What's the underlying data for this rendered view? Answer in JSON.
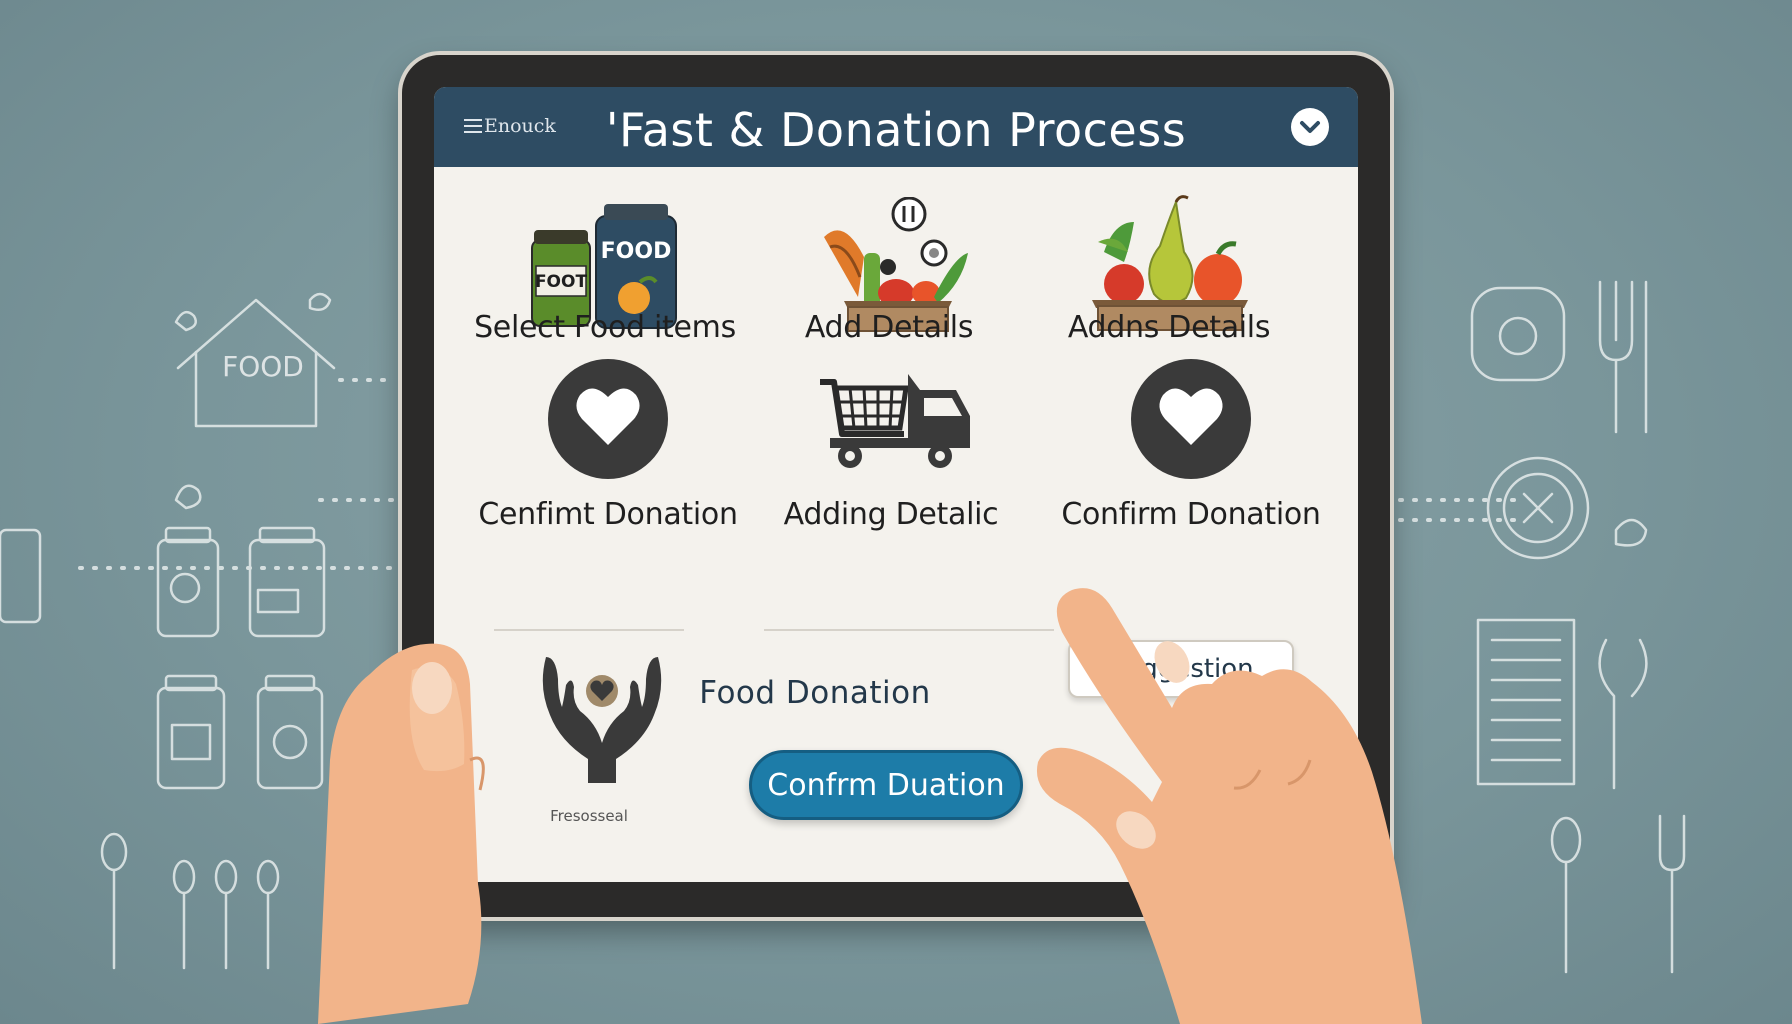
{
  "header": {
    "menu_label": "Enouck",
    "title": "'Fast & Donation Process",
    "chevron_icon": "chevron-down-icon"
  },
  "steps": [
    {
      "label": "Select Food items",
      "icon": "food-jars-icon",
      "jar_labels": [
        "FOOD",
        "FOOT"
      ]
    },
    {
      "label": "Add Details",
      "icon": "vegetable-basket-icon"
    },
    {
      "label": "Addns Details",
      "icon": "fruit-basket-icon"
    },
    {
      "label": "Cenfimt Donation",
      "icon": "heart-circle-icon"
    },
    {
      "label": "Adding Detalic",
      "icon": "delivery-truck-icon"
    },
    {
      "label": "Confirm Donation",
      "icon": "heart-circle-icon"
    }
  ],
  "bottom": {
    "hands_caption": "Fresosseal",
    "food_donation_text": "Food   Donation",
    "confirm_button_label": "Confrm Duation",
    "suggestion_button_label": "Suggestion"
  },
  "background": {
    "house_label": "FOOD"
  },
  "colors": {
    "background": "#7a969b",
    "header": "#2e4c63",
    "screen": "#f4f2ed",
    "confirm_button": "#1d7ca8",
    "icon_dark": "#3a3a3a",
    "skin": "#f2b48a"
  }
}
